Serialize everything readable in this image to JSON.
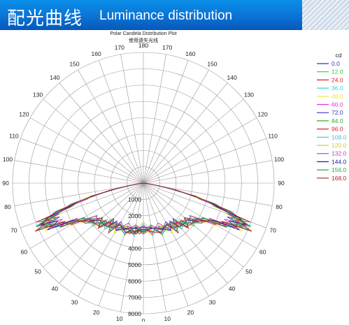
{
  "header": {
    "title_cn": "配光曲线",
    "title_en": "Luminance distribution"
  },
  "colors": {
    "banner": "#0b73d6",
    "grid": "#9a9a9a"
  },
  "chart_data": {
    "type": "polar-line",
    "title": "Polar Candela Distribution Plot",
    "subtitle": "使用遗失光线",
    "angle_labels_left": [
      180,
      170,
      160,
      150,
      140,
      130,
      120,
      110,
      100,
      90,
      80,
      70,
      60,
      50,
      40,
      30,
      20,
      10
    ],
    "angle_labels_right": [
      170,
      160,
      150,
      140,
      130,
      120,
      110,
      100,
      90,
      80,
      70,
      60,
      50,
      40,
      30,
      20,
      10
    ],
    "bottom_angle_label": "0",
    "radial_labels": [
      "1000",
      "2000",
      "3000",
      "4000",
      "5000",
      "6000",
      "7000",
      "8000"
    ],
    "radial_max": 8000,
    "legend_title": "cd",
    "series": [
      {
        "name": "0.0",
        "color": "#3333cc"
      },
      {
        "name": "12.0",
        "color": "#33cc33"
      },
      {
        "name": "24.0",
        "color": "#e0212a"
      },
      {
        "name": "36.0",
        "color": "#33d6e0"
      },
      {
        "name": "48.0",
        "color": "#f2ea2a"
      },
      {
        "name": "60.0",
        "color": "#e033d6"
      },
      {
        "name": "72.0",
        "color": "#3333cc"
      },
      {
        "name": "84.0",
        "color": "#33aa33"
      },
      {
        "name": "96.0",
        "color": "#e0212a"
      },
      {
        "name": "108.0",
        "color": "#44bde0"
      },
      {
        "name": "120.0",
        "color": "#d9c82a"
      },
      {
        "name": "132.0",
        "color": "#cc33cc"
      },
      {
        "name": "144.0",
        "color": "#222288"
      },
      {
        "name": "156.0",
        "color": "#22aa44"
      },
      {
        "name": "168.0",
        "color": "#b01e2e"
      }
    ],
    "angles_deg": [
      0,
      10,
      20,
      30,
      35,
      40,
      45,
      50,
      55,
      60,
      62,
      64,
      66,
      68,
      70,
      72,
      74,
      76,
      78,
      80,
      85,
      90
    ],
    "base_candela": [
      2800,
      2900,
      3000,
      3100,
      3200,
      3300,
      3500,
      3700,
      3900,
      4600,
      5200,
      5900,
      6300,
      6500,
      6100,
      5200,
      4100,
      3000,
      1900,
      900,
      200,
      0
    ]
  }
}
